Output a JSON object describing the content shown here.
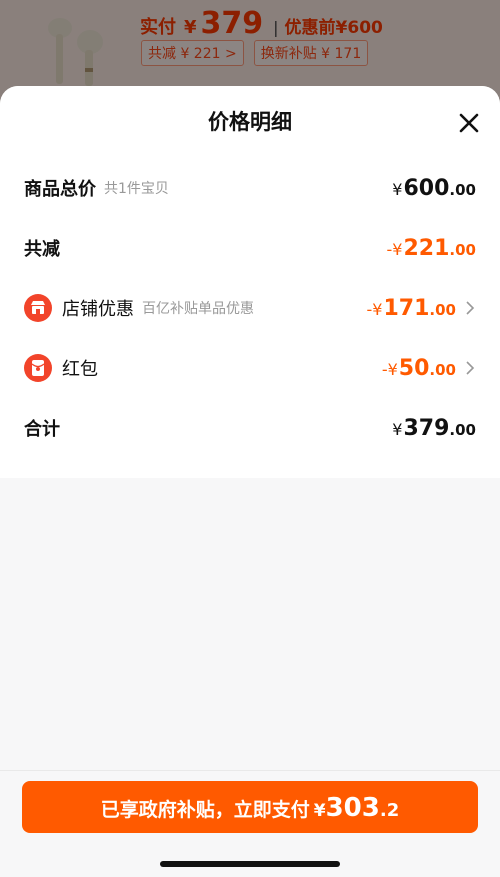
{
  "top": {
    "pay_label": "实付",
    "currency": "¥",
    "pay_amount": "379",
    "separator": "|",
    "before_label": "优惠前¥600",
    "chips": [
      "共减 ¥ 221 >",
      "换新补贴 ¥ 171"
    ]
  },
  "sheet": {
    "title": "价格明细"
  },
  "rows": {
    "total": {
      "label": "商品总价",
      "sub": "共1件宝贝",
      "yen": "¥",
      "int": "600",
      "dec": ".00"
    },
    "discount": {
      "label": "共减",
      "yen": "-¥",
      "int": "221",
      "dec": ".00"
    },
    "shop": {
      "label": "店铺优惠",
      "sub": "百亿补贴单品优惠",
      "yen": "-¥",
      "int": "171",
      "dec": ".00",
      "icon": "shop-icon"
    },
    "redpacket": {
      "label": "红包",
      "yen": "-¥",
      "int": "50",
      "dec": ".00",
      "icon": "red-packet-icon"
    },
    "sum": {
      "label": "合计",
      "yen": "¥",
      "int": "379",
      "dec": ".00"
    }
  },
  "footer": {
    "button_text": "已享政府补贴，立即支付",
    "yen": "¥",
    "int": "303",
    "dec": ".2"
  },
  "colors": {
    "accent": "#ff5a00",
    "icon_red": "#f2442a"
  }
}
